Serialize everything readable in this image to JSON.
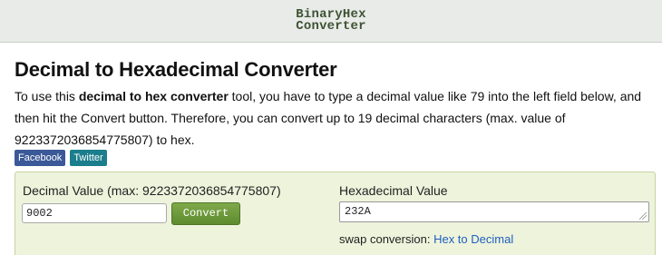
{
  "header": {
    "brand_line1": "BinaryHex",
    "brand_line2": "Converter"
  },
  "page": {
    "title": "Decimal to Hexadecimal Converter",
    "intro_before": "To use this ",
    "intro_bold": "decimal to hex converter",
    "intro_after": " tool, you have to type a decimal value like 79 into the left field below, and then hit the Convert button. Therefore, you can convert up to 19 decimal characters (max. value of 9223372036854775807) to hex."
  },
  "social": {
    "facebook": "Facebook",
    "twitter": "Twitter"
  },
  "converter": {
    "decimal_label": "Decimal Value (max: 9223372036854775807)",
    "decimal_value": "9002",
    "convert_label": "Convert",
    "hex_label": "Hexadecimal Value",
    "hex_value": "232A",
    "swap_prefix": "swap conversion:",
    "swap_link": "Hex to Decimal"
  },
  "colors": {
    "header_bg": "#e8ebe8",
    "brand": "#3e5234",
    "panel_bg": "#eef3dc",
    "convert_button": "#6a9a38",
    "facebook": "#3b5998",
    "twitter": "#1b7e8c",
    "link": "#1f5fbf"
  }
}
